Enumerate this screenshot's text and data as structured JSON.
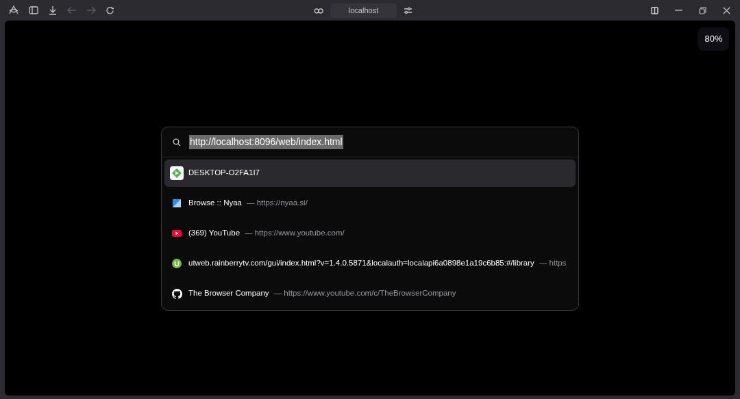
{
  "toolbar": {
    "address": "localhost"
  },
  "zoom_badge": "80%",
  "command_bar": {
    "query": "http://localhost:8096/web/index.html",
    "results": [
      {
        "kind": "emby",
        "title": "DESKTOP-O2FA1I7",
        "selected": true
      },
      {
        "kind": "nyaa",
        "title": "Browse :: Nyaa",
        "url": "— https://nyaa.si/",
        "selected": false
      },
      {
        "kind": "youtube",
        "title": "(369) YouTube",
        "url": "— https://www.youtube.com/",
        "selected": false
      },
      {
        "kind": "utorrent",
        "title": "utweb.rainberrytv.com/gui/index.html?v=1.4.0.5871&localauth=localapi6a0898e1a19c6b85:#/library",
        "url": "— https",
        "selected": false
      },
      {
        "kind": "github",
        "title": "The Browser Company",
        "url": "— https://www.youtube.com/c/TheBrowserCompany",
        "selected": false
      }
    ]
  }
}
